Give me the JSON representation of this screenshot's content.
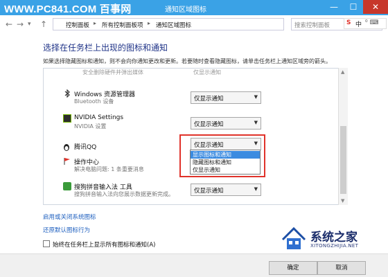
{
  "watermark": "WWW.PC841.COM 百事网",
  "window": {
    "title": "通知区域图标",
    "min": "—",
    "max": "☐",
    "close": "✕"
  },
  "nav": {
    "back": "←",
    "forward": "→",
    "history": "▾",
    "up": "↑",
    "breadcrumb": [
      "控制面板",
      "所有控制面板项",
      "通知区域图标"
    ],
    "sep": "▸",
    "search_placeholder": "搜索控制面板"
  },
  "ime": {
    "label": "中",
    "icons": "⁰ ⌨"
  },
  "heading": "选择在任务栏上出现的图标和通知",
  "description": "如果选择隐藏图标和通知，则不会向你通知更改和更新。若要随时查看隐藏图标，请单击任务栏上通知区域旁的箭头。",
  "columns": {
    "left": "安全删除硬件并弹出媒体",
    "right": "仅显示通知"
  },
  "items": [
    {
      "name": "Windows 资源管理器",
      "sub": "Bluetooth 设备",
      "value": "仅显示通知"
    },
    {
      "name": "NVIDIA Settings",
      "sub": "NVIDIA 设置",
      "value": "仅显示通知"
    },
    {
      "name": "腾讯QQ",
      "sub": "",
      "value": "仅显示通知"
    },
    {
      "name": "操作中心",
      "sub": "解决电脑问题: 1 条重要消息",
      "value": ""
    },
    {
      "name": "搜狗拼音输入法 工具",
      "sub": "搜狗拼音输入法向您展示数据更新完成。",
      "value": "仅显示通知"
    }
  ],
  "dropdown_options": [
    "显示图标和通知",
    "隐藏图标和通知",
    "仅显示通知"
  ],
  "links": {
    "system_icons": "启用或关闭系统图标",
    "restore": "还原默认图标行为"
  },
  "always_show": "始终在任务栏上显示所有图标和通知(A)",
  "buttons": {
    "ok": "确定",
    "cancel": "取消"
  },
  "logo": {
    "cn": "系统之家",
    "en": "XITONGZHIJIA.NET"
  },
  "colors": {
    "titlebar": "#3aa2e6",
    "highlight": "#e0322a",
    "selected": "#3b8be0",
    "heading": "#1e3287",
    "link": "#1e5fbf"
  }
}
